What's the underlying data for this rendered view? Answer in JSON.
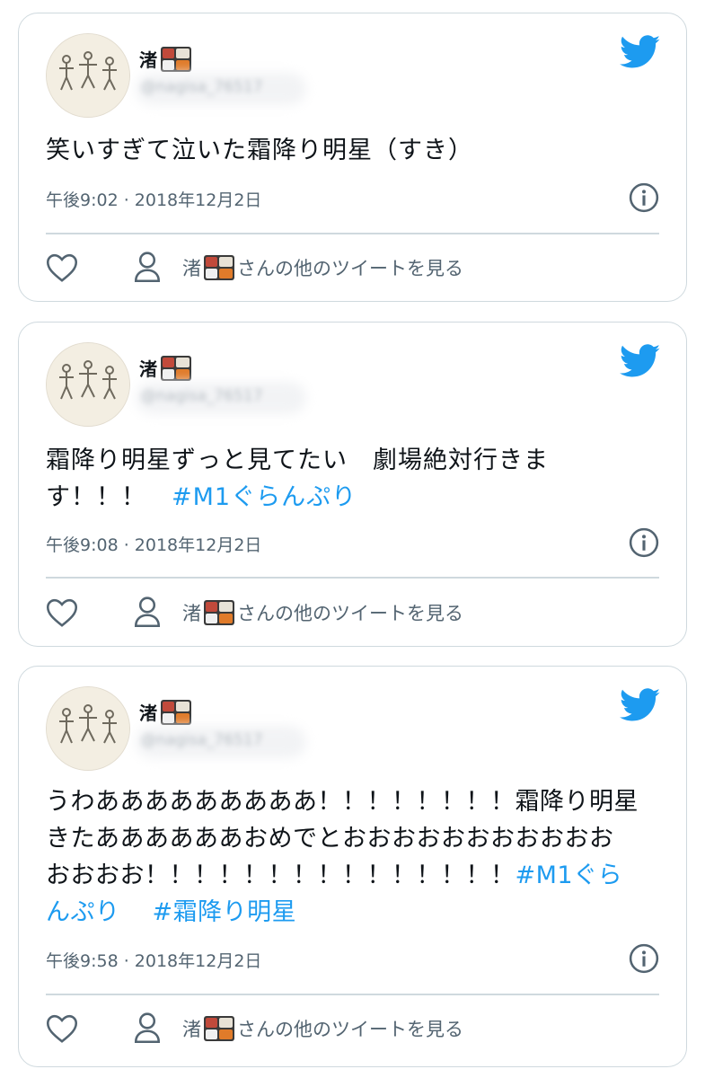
{
  "tweets": [
    {
      "author": "渚",
      "handle": "@nagisa_76517",
      "lines": [
        "笑いすぎて泣いた霜降り明星（すき）"
      ],
      "hashtags": [],
      "time": "午後9:02 · 2018年12月2日",
      "more_prefix": "渚",
      "more_suffix": "さんの他のツイートを見る"
    },
    {
      "author": "渚",
      "handle": "@nagisa_76517",
      "lines": [
        "霜降り明星ずっと見てたい　劇場絶対行きま",
        "す！！！　"
      ],
      "hashtag_line2": "#M1ぐらんぷり",
      "time": "午後9:08 · 2018年12月2日",
      "more_prefix": "渚",
      "more_suffix": "さんの他のツイートを見る"
    },
    {
      "author": "渚",
      "handle": "@nagisa_76517",
      "lines": [
        "うわあああああああああ！！！！！！！！霜降り明星",
        "きたああああああおめでとおおおおおおおおおおお",
        "おおおお！！！！！！！！！！！！！！！"
      ],
      "hashtag_line3": "#M1ぐら",
      "line4_hashtag_a": "んぷり",
      "line4_hashtag_b": "#霜降り明星",
      "time": "午後9:58 · 2018年12月2日",
      "more_prefix": "渚",
      "more_suffix": "さんの他のツイートを見る"
    }
  ],
  "icons": {
    "brand": "twitter-bird-icon",
    "info": "info-icon",
    "like": "heart-icon",
    "profile": "person-icon",
    "emoji": "bento-box-emoji"
  },
  "colors": {
    "accent": "#1d9bf0",
    "muted": "#536471",
    "border": "#cfd9de"
  }
}
